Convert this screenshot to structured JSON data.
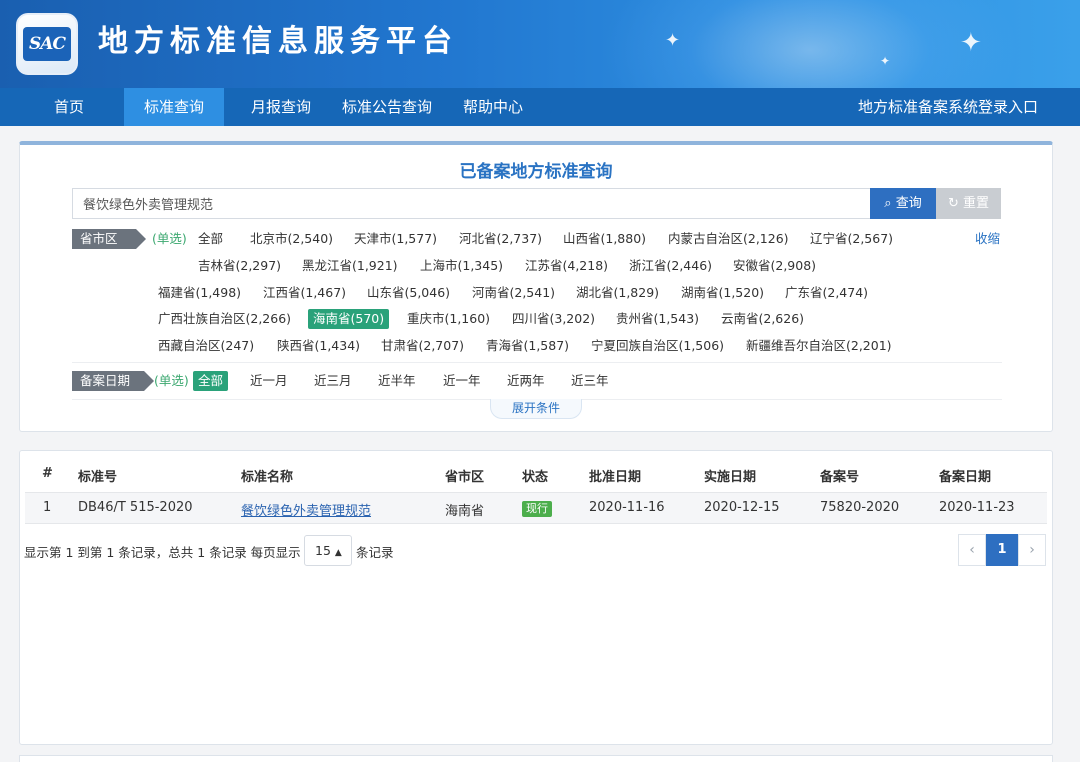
{
  "header": {
    "logo_text": "SAC",
    "site_title": "地方标准信息服务平台"
  },
  "nav": {
    "items": [
      {
        "label": "首页",
        "active": false
      },
      {
        "label": "标准查询",
        "active": true
      },
      {
        "label": "月报查询",
        "active": false
      },
      {
        "label": "标准公告查询",
        "active": false
      },
      {
        "label": "帮助中心",
        "active": false
      }
    ],
    "login": "地方标准备案系统登录入口"
  },
  "search": {
    "title": "已备案地方标准查询",
    "query": "餐饮绿色外卖管理规范",
    "search_label": "查询",
    "reset_label": "重置",
    "region": {
      "label": "省市区",
      "mode": "(单选)",
      "collapse": "收缩",
      "options": [
        "全部",
        "北京市(2,540)",
        "天津市(1,577)",
        "河北省(2,737)",
        "山西省(1,880)",
        "内蒙古自治区(2,126)",
        "辽宁省(2,567)",
        "吉林省(2,297)",
        "黑龙江省(1,921)",
        "上海市(1,345)",
        "江苏省(4,218)",
        "浙江省(2,446)",
        "安徽省(2,908)",
        "福建省(1,498)",
        "江西省(1,467)",
        "山东省(5,046)",
        "河南省(2,541)",
        "湖北省(1,829)",
        "湖南省(1,520)",
        "广东省(2,474)",
        "广西壮族自治区(2,266)",
        "海南省(570)",
        "重庆市(1,160)",
        "四川省(3,202)",
        "贵州省(1,543)",
        "云南省(2,626)",
        "西藏自治区(247)",
        "陕西省(1,434)",
        "甘肃省(2,707)",
        "青海省(1,587)",
        "宁夏回族自治区(1,506)",
        "新疆维吾尔自治区(2,201)"
      ],
      "selected": "海南省(570)"
    },
    "date": {
      "label": "备案日期",
      "mode": "(单选)",
      "options": [
        "全部",
        "近一月",
        "近三月",
        "近半年",
        "近一年",
        "近两年",
        "近三年"
      ],
      "selected": "全部"
    },
    "expand": "展开条件"
  },
  "table": {
    "columns": [
      "#",
      "标准号",
      "标准名称",
      "省市区",
      "状态",
      "批准日期",
      "实施日期",
      "备案号",
      "备案日期"
    ],
    "rows": [
      {
        "no": "1",
        "code": "DB46/T 515-2020",
        "name": "餐饮绿色外卖管理规范",
        "region": "海南省",
        "status": "现行",
        "approve_date": "2020-11-16",
        "implement_date": "2020-12-15",
        "record_no": "75820-2020",
        "record_date": "2020-11-23"
      }
    ]
  },
  "pagination": {
    "info": "显示第 1 到第 1 条记录，总共 1 条记录 每页显示",
    "page_size": "15",
    "unit": "条记录",
    "prev": "‹",
    "current": "1",
    "next": "›"
  },
  "colors": {
    "nav_bg": "#1667b7",
    "nav_active": "#2e8fe2",
    "selected_option": "#2aa27a",
    "status_current": "#4cae4c",
    "primary_button": "#2e6fc1"
  }
}
